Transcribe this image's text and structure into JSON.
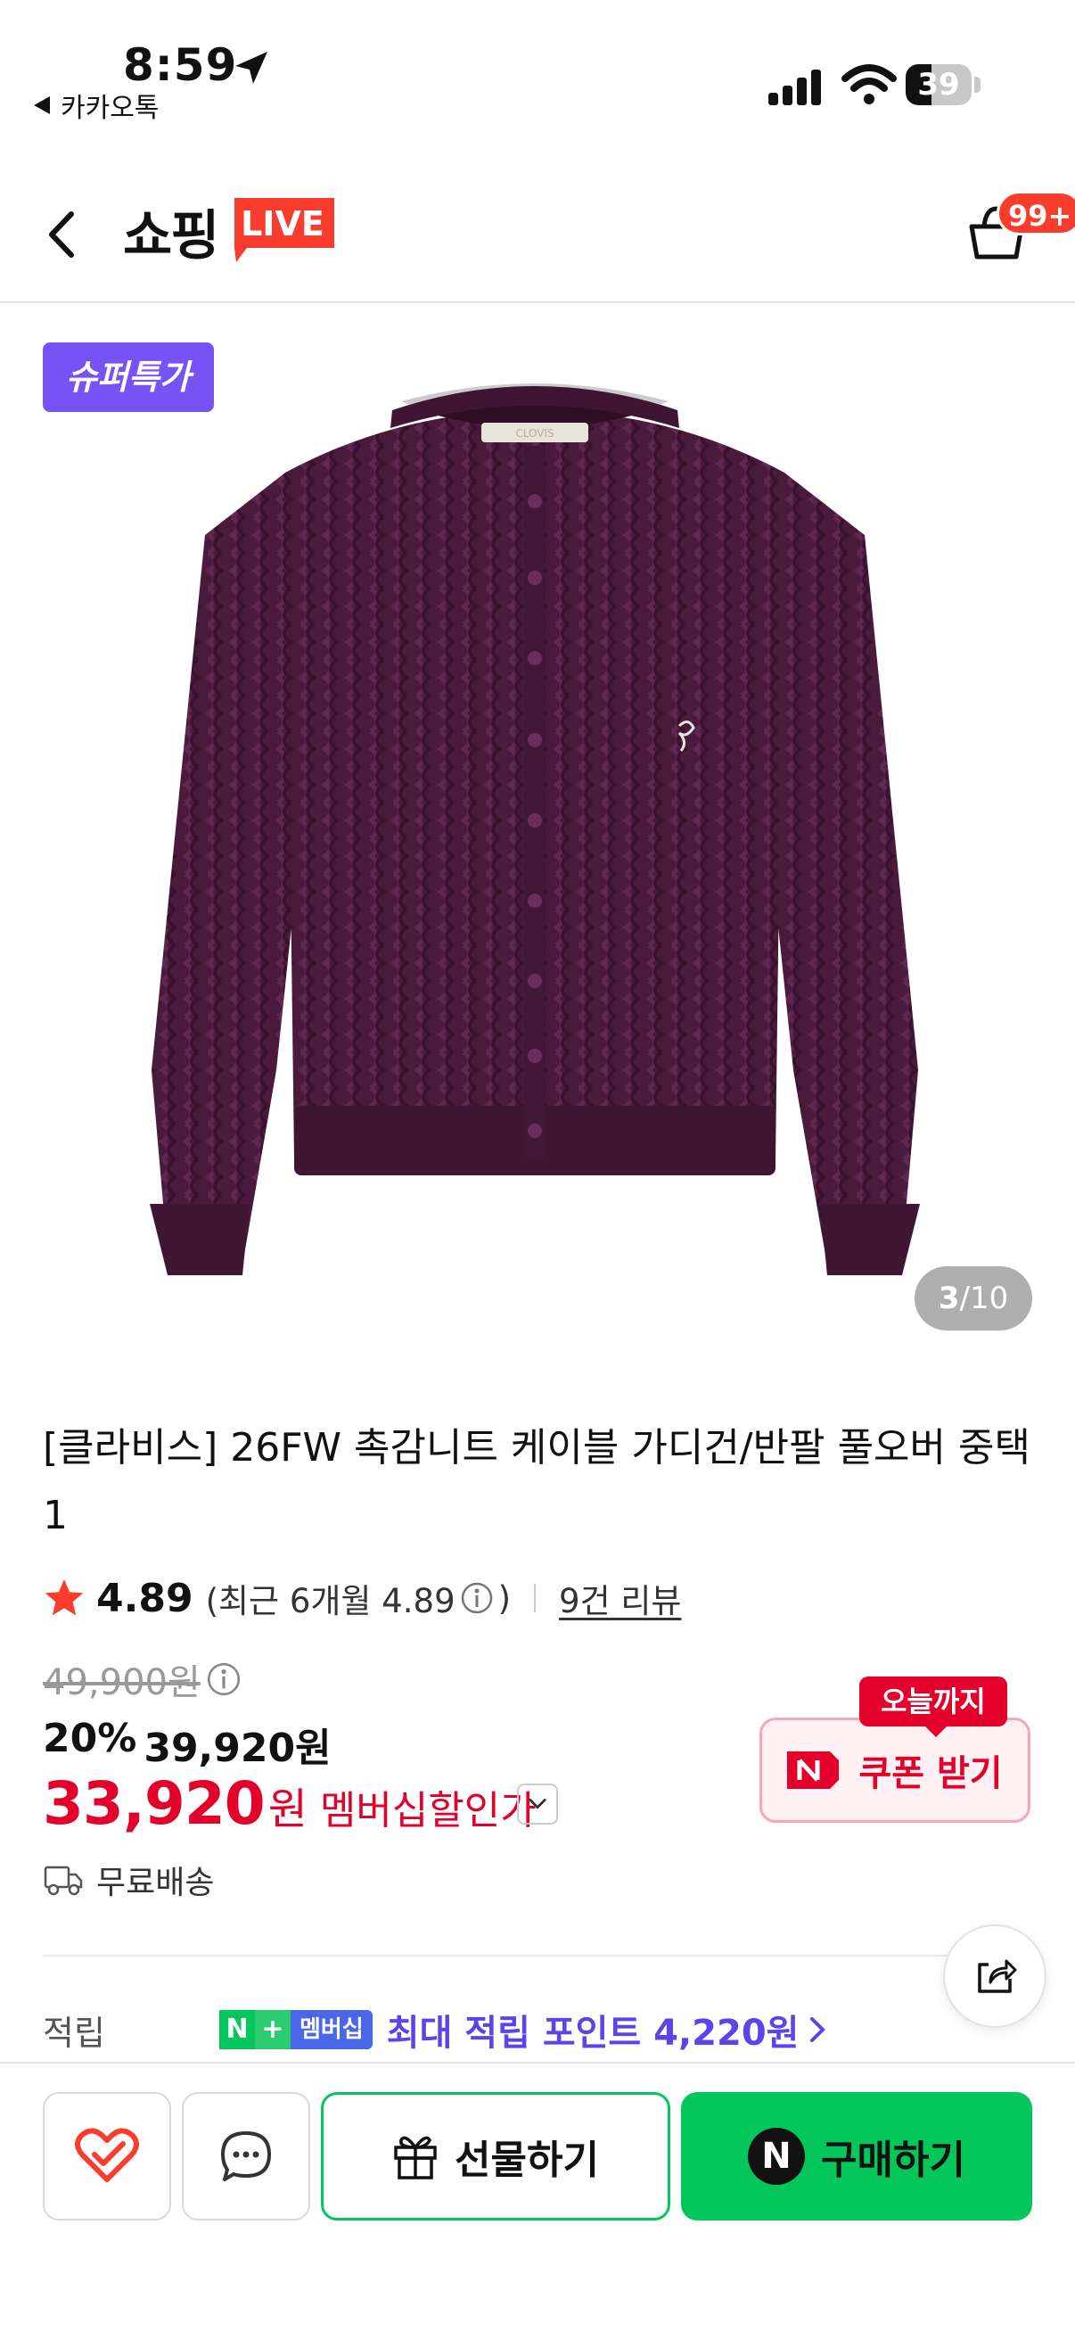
{
  "status_bar": {
    "time": "8:59",
    "back_app": "카카오톡",
    "battery": "39",
    "battery_level": 0.39
  },
  "header": {
    "logo_text": "쇼핑",
    "logo_live": "LIVE",
    "cart_badge": "99+"
  },
  "product_image": {
    "badge": "슈퍼특가",
    "current": "3",
    "separator": "/",
    "total": "10",
    "label_text": "CLOVIS"
  },
  "product": {
    "title": "[클라비스] 26FW 촉감니트 케이블 가디건/반팔 풀오버 중택1",
    "rating": "4.89",
    "recent_rating_prefix": "(최근 6개월 4.89",
    "recent_rating_suffix": ")",
    "review_link": "9건 리뷰",
    "original_price": "49,900원",
    "discount": "20%",
    "sale_price": "39,920원",
    "member_price": "33,920",
    "member_won": "원",
    "member_label": "멤버십할인가",
    "shipping": "무료배송"
  },
  "coupon": {
    "badge": "오늘까지",
    "label": "쿠폰 받기"
  },
  "points": {
    "label": "적립",
    "badge_n": "N",
    "badge_plus": "+",
    "badge_member": "멤버십",
    "text": "최대 적립 포인트 4,220원"
  },
  "bottom_bar": {
    "gift_label": "선물하기",
    "buy_n": "N",
    "buy_label": "구매하기"
  },
  "colors": {
    "accent_purple": "#7752f5",
    "price_red": "#e3002b",
    "naver_green": "#03c75a",
    "sweater": "#4a1a3c"
  }
}
